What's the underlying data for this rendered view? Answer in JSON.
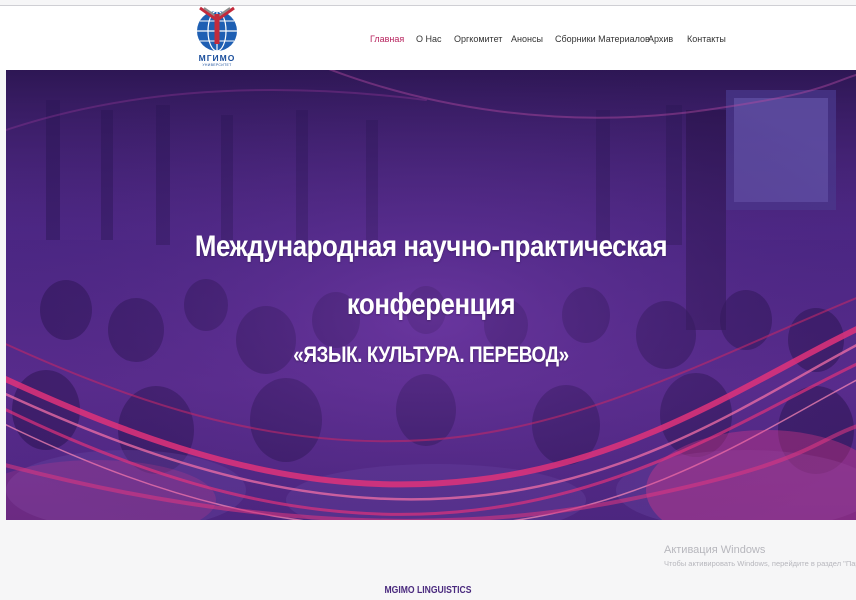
{
  "logo": {
    "name": "МГИМО",
    "subtitle": "УНИВЕРСИТЕТ"
  },
  "nav": {
    "items": [
      {
        "label": "Главная",
        "active": true
      },
      {
        "label": "О Нас",
        "active": false
      },
      {
        "label": "Оргкомитет",
        "active": false
      },
      {
        "label": "Анонсы",
        "active": false
      },
      {
        "label": "Сборники Материалов",
        "active": false
      },
      {
        "label": "Архив",
        "active": false
      },
      {
        "label": "Контакты",
        "active": false
      }
    ],
    "active_color": "#b8255f",
    "text_color": "#333333"
  },
  "hero": {
    "title_line1": "Международная научно-практическая",
    "title_line2": "конференция",
    "subtitle": "«ЯЗЫК. КУЛЬТУРА. ПЕРЕВОД»",
    "overlay_color": "#4a2683",
    "ribbon_color": "#e0327a"
  },
  "watermark": {
    "title": "Активация Windows",
    "text": "Чтобы активировать Windows, перейдите в раздел \"Пара"
  },
  "brand": {
    "label": "MGIMO LINGUISTICS"
  }
}
